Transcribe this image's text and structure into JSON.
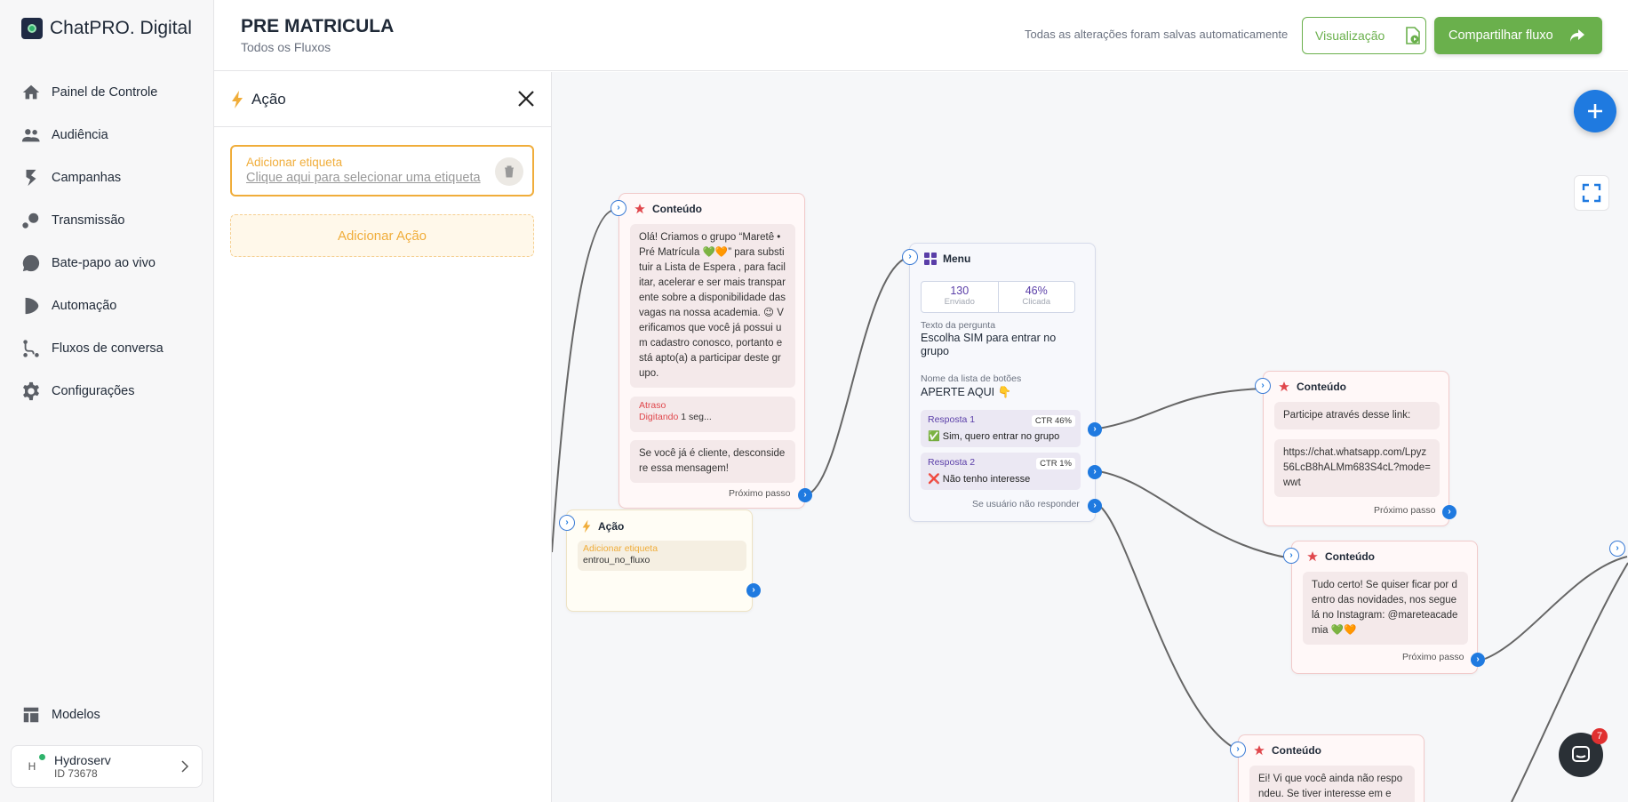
{
  "brand": {
    "name": "ChatPRO. Digital"
  },
  "sidebar": {
    "items": [
      {
        "label": "Painel de Controle",
        "icon": "home-icon"
      },
      {
        "label": "Audiência",
        "icon": "users-icon"
      },
      {
        "label": "Campanhas",
        "icon": "campaign-icon"
      },
      {
        "label": "Transmissão",
        "icon": "broadcast-icon"
      },
      {
        "label": "Bate-papo ao vivo",
        "icon": "chat-icon"
      },
      {
        "label": "Automação",
        "icon": "automation-icon"
      },
      {
        "label": "Fluxos de conversa",
        "icon": "flow-icon"
      },
      {
        "label": "Configurações",
        "icon": "gear-icon"
      }
    ],
    "models_label": "Modelos",
    "account": {
      "avatar": "H",
      "name": "Hydroserv",
      "id": "ID 73678"
    }
  },
  "header": {
    "title": "PRE MATRICULA",
    "subtitle": "Todos os Fluxos",
    "autosave": "Todas as alterações foram salvas automaticamente",
    "view_label": "Visualização",
    "share_label": "Compartilhar fluxo"
  },
  "panel": {
    "title": "Ação",
    "tag_label": "Adicionar etiqueta",
    "tag_placeholder": "Clique aqui para selecionar uma etiqueta",
    "add_action_label": "Adicionar Ação"
  },
  "canvas": {
    "chat_badge": "7",
    "nodes": {
      "content1": {
        "title": "Conteúdo",
        "message": "Olá! Criamos o grupo “Maretê • Pré Matrícula 💚🧡” para substituir a Lista de Espera , para facilitar, acelerar e ser mais transparente sobre a disponibilidade das vagas na nossa academia. 😉 Verificamos que você já possui um cadastro conosco, portanto está apto(a) a participar deste grupo.",
        "delay_title": "Atraso",
        "delay_label": "Digitando",
        "delay_value": "1 seg...",
        "message2": "Se você já é cliente, desconsidere essa mensagem!",
        "next": "Próximo passo"
      },
      "action1": {
        "title": "Ação",
        "tag_label": "Adicionar etiqueta",
        "tag_value": "entrou_no_fluxo"
      },
      "menu": {
        "title": "Menu",
        "sent_value": "130",
        "sent_label": "Enviado",
        "clicked_value": "46%",
        "clicked_label": "Clicada",
        "question_label": "Texto da pergunta",
        "question": "Escolha SIM para entrar no grupo",
        "list_label": "Nome da lista de botões",
        "list_name": "APERTE AQUI 👇",
        "responses": [
          {
            "label": "Resposta 1",
            "ctr": "CTR 46%",
            "text": "✅ Sim, quero entrar no grupo"
          },
          {
            "label": "Resposta 2",
            "ctr": "CTR 1%",
            "text": "❌ Não tenho interesse"
          }
        ],
        "no_reply": "Se usuário não responder"
      },
      "content2": {
        "title": "Conteúdo",
        "message": "Participe através desse link:",
        "link": "https://chat.whatsapp.com/Lpyz56LcB8hALMm683S4cL?mode=wwt",
        "next": "Próximo passo"
      },
      "content3": {
        "title": "Conteúdo",
        "message": "Tudo certo! Se quiser ficar por dentro das novidades, nos segue lá no Instagram: @mareteacademia 💚🧡",
        "next": "Próximo passo"
      },
      "content4": {
        "title": "Conteúdo",
        "message": "Ei! Vi que você ainda não respondeu. Se tiver interesse em e"
      }
    }
  },
  "colors": {
    "accent_green": "#6ab04c",
    "accent_blue": "#1f7ae0",
    "accent_orange": "#f0ad3a"
  }
}
